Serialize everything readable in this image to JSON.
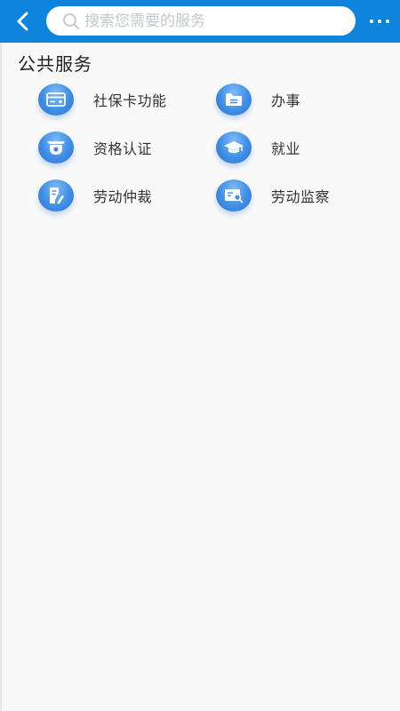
{
  "header": {
    "back_icon": "chevron-left-icon",
    "search_placeholder": "搜索您需要的服务",
    "more_icon": "more-horizontal-icon",
    "color": "#0f84dc"
  },
  "section": {
    "title": "公共服务"
  },
  "services": [
    {
      "label": "社保卡功能",
      "icon": "card-icon"
    },
    {
      "label": "办事",
      "icon": "folder-icon"
    },
    {
      "label": "资格认证",
      "icon": "badge-icon"
    },
    {
      "label": "就业",
      "icon": "graduation-cap-icon"
    },
    {
      "label": "劳动仲裁",
      "icon": "document-edit-icon"
    },
    {
      "label": "劳动监察",
      "icon": "inspect-icon"
    }
  ]
}
